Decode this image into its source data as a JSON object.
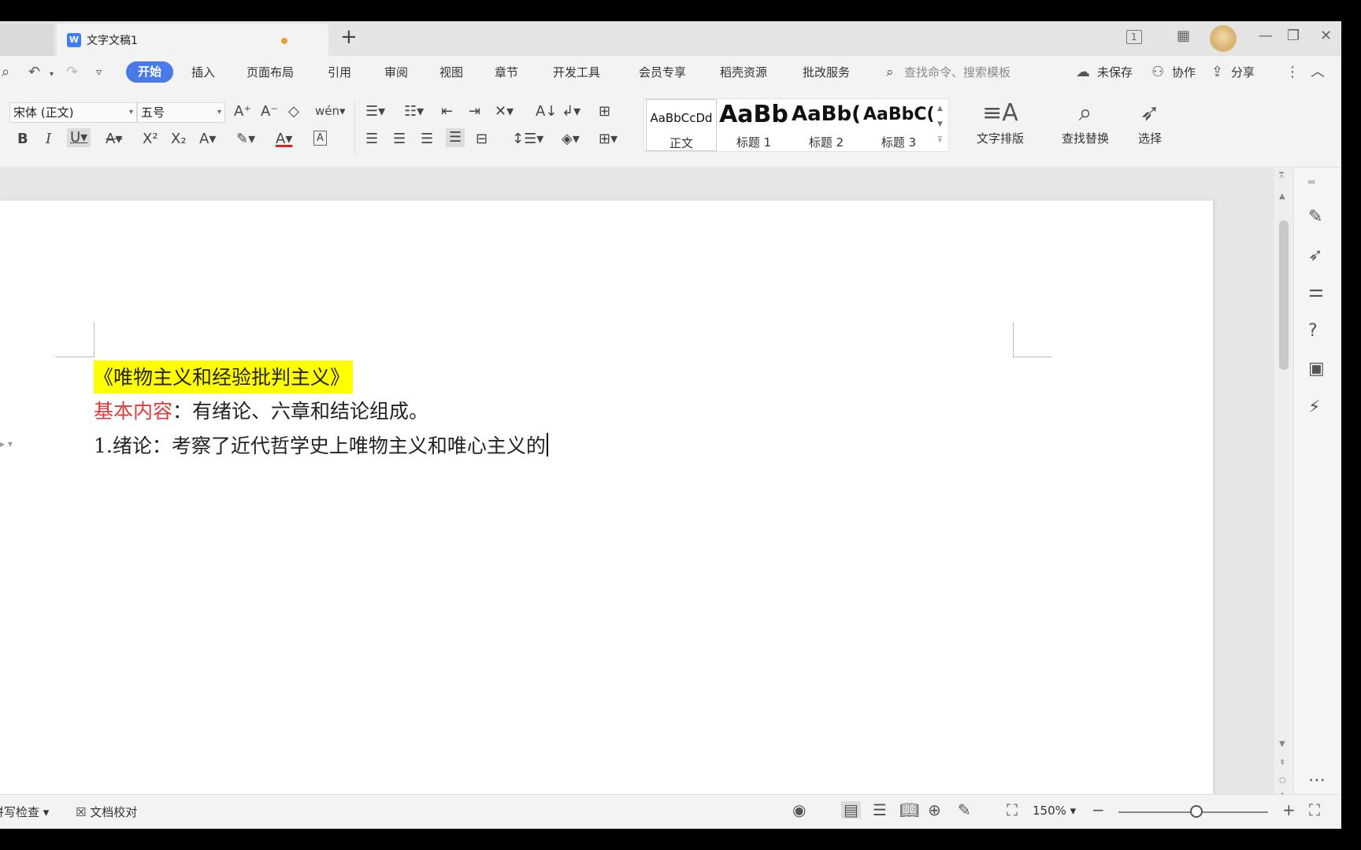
{
  "tab": {
    "title": "文字文稿1",
    "logo": "W"
  },
  "menu": {
    "items": [
      "开始",
      "插入",
      "页面布局",
      "引用",
      "审阅",
      "视图",
      "章节",
      "开发工具",
      "会员专享",
      "稻壳资源",
      "批改服务"
    ],
    "search_placeholder": "查找命令、搜索模板",
    "unsaved": "未保存",
    "collaborate": "协作",
    "share": "分享"
  },
  "ribbon": {
    "font_name": "宋体 (正文)",
    "font_size": "五号",
    "styles": [
      {
        "preview": "AaBbCcDd",
        "label": "正文"
      },
      {
        "preview": "AaBb",
        "label": "标题 1"
      },
      {
        "preview": "AaBb(",
        "label": "标题 2"
      },
      {
        "preview": "AaBbC(",
        "label": "标题 3"
      }
    ],
    "text_layout": "文字排版",
    "find_replace": "查找替换",
    "select": "选择"
  },
  "document": {
    "title": "《唯物主义和经验批判主义》",
    "basic_label": "基本内容",
    "basic_text": "：有绪论、六章和结论组成。",
    "intro_line": "1.绪论：考察了近代哲学史上唯物主义和唯心主义的"
  },
  "status": {
    "spellcheck": "拼写检查",
    "doc_check": "文档校对",
    "zoom": "150%",
    "zoom_fraction": 0.52
  }
}
